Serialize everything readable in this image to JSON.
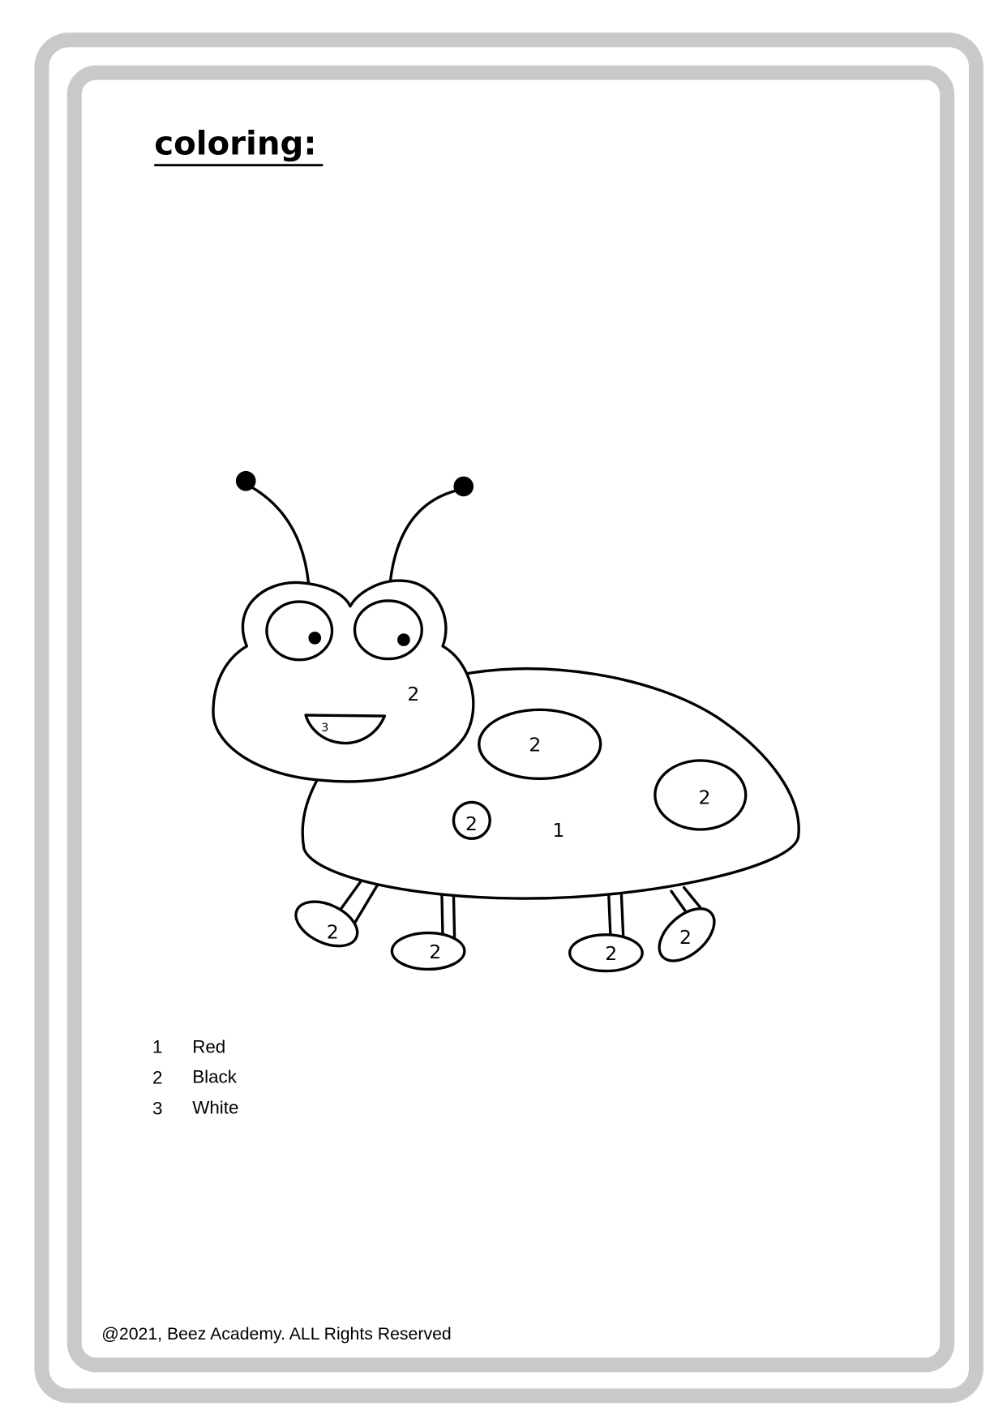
{
  "title": "coloring:",
  "drawing_labels": {
    "head": "2",
    "mouth": "3",
    "spot_top": "2",
    "spot_right": "2",
    "spot_small": "2",
    "body": "1",
    "foot_back_left": "2",
    "foot_front_left": "2",
    "foot_front_right": "2",
    "foot_back_right": "2"
  },
  "legend": [
    {
      "number": "1",
      "color": "Red"
    },
    {
      "number": "2",
      "color": "Black"
    },
    {
      "number": "3",
      "color": "White"
    }
  ],
  "footer": "@2021, Beez Academy. ALL Rights Reserved",
  "colors": {
    "border": "#c9c9c9",
    "ink": "#000000",
    "paper": "#ffffff"
  }
}
